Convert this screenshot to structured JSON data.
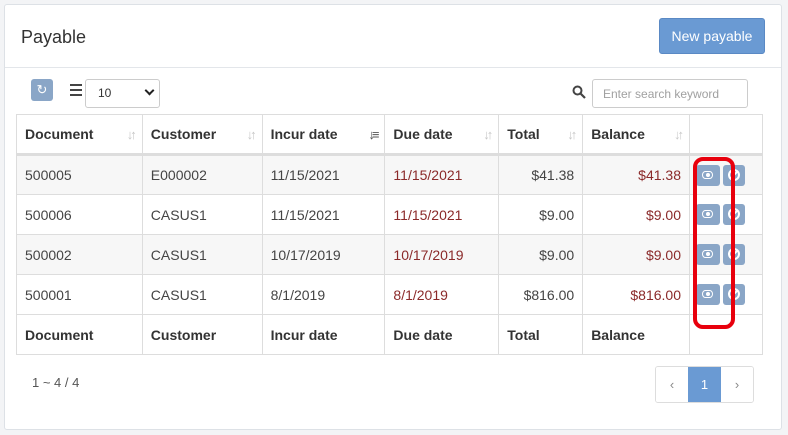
{
  "header": {
    "title": "Payable",
    "new_button": "New payable"
  },
  "toolbar": {
    "refresh_icon": "refresh-icon",
    "list_icon": "list-icon",
    "page_size": "10",
    "search_icon": "search-icon",
    "search_placeholder": "Enter search keyword"
  },
  "table": {
    "columns": [
      "Document",
      "Customer",
      "Incur date",
      "Due date",
      "Total",
      "Balance"
    ],
    "sort_icon": "sort-icon",
    "rows": [
      {
        "document": "500005",
        "customer": "E000002",
        "incur_date": "11/15/2021",
        "due_date": "11/15/2021",
        "total": "$41.38",
        "balance": "$41.38"
      },
      {
        "document": "500006",
        "customer": "CASUS1",
        "incur_date": "11/15/2021",
        "due_date": "11/15/2021",
        "total": "$9.00",
        "balance": "$9.00"
      },
      {
        "document": "500002",
        "customer": "CASUS1",
        "incur_date": "10/17/2019",
        "due_date": "10/17/2019",
        "total": "$9.00",
        "balance": "$9.00"
      },
      {
        "document": "500001",
        "customer": "CASUS1",
        "incur_date": "8/1/2019",
        "due_date": "8/1/2019",
        "total": "$816.00",
        "balance": "$816.00"
      }
    ],
    "footer": [
      "Document",
      "Customer",
      "Incur date",
      "Due date",
      "Total",
      "Balance"
    ]
  },
  "pagination": {
    "summary": "1 ~ 4 / 4",
    "prev": "‹",
    "current": "1",
    "next": "›"
  },
  "colors": {
    "accent": "#6a9ad3",
    "action_button": "#8aa6c7",
    "due_text": "#8b2a2a",
    "highlight": "#e8000d"
  }
}
